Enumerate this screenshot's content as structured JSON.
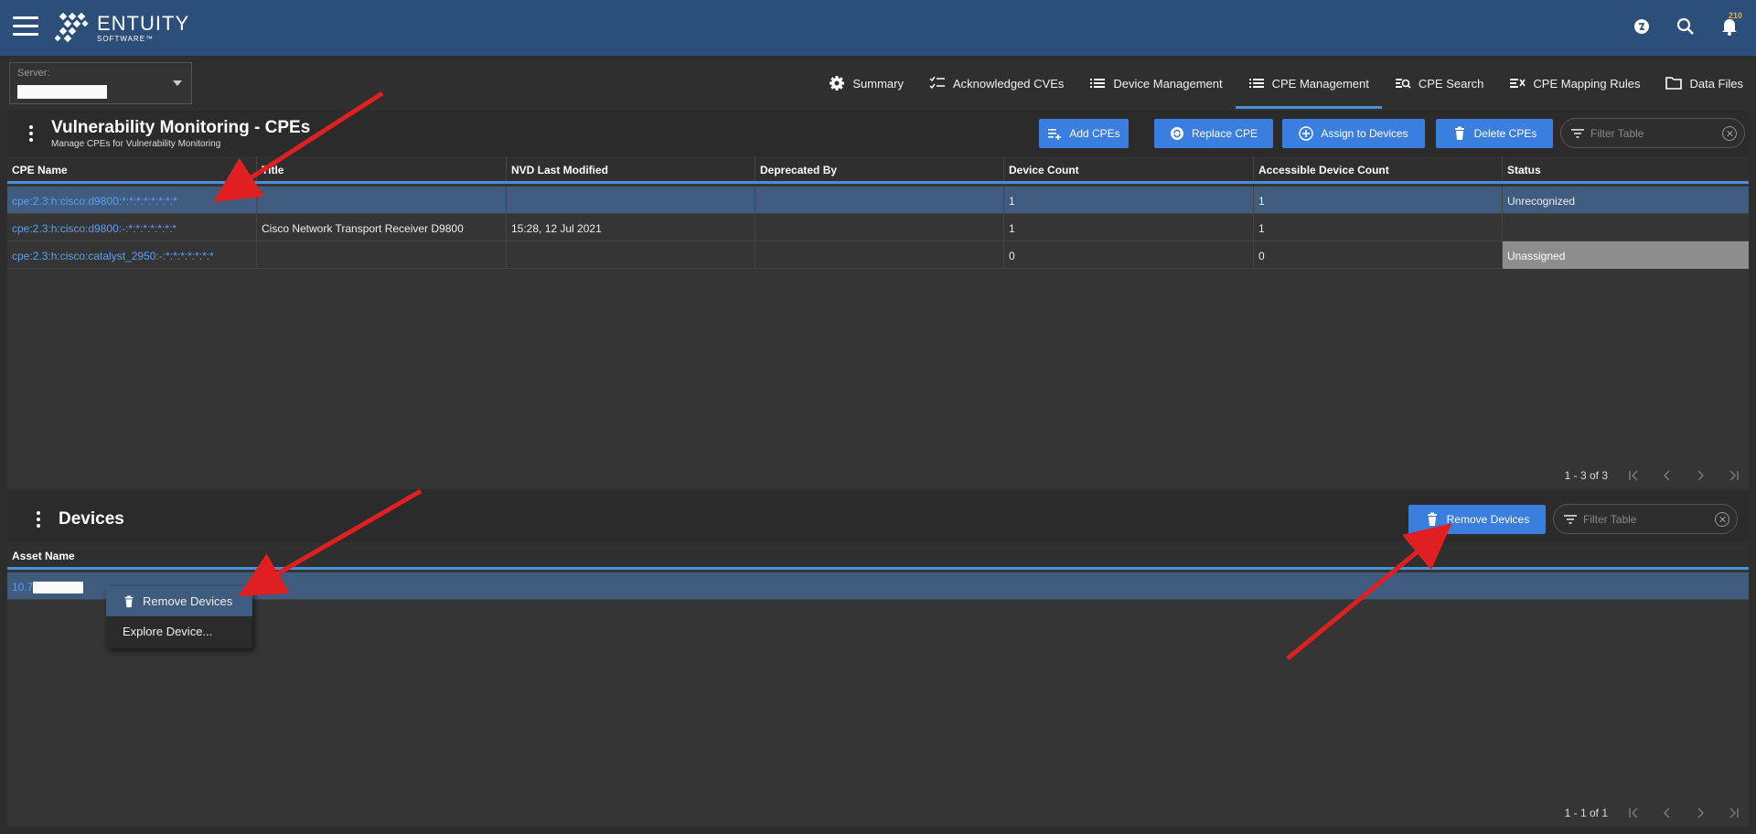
{
  "header": {
    "logo_main": "ENTUITY",
    "logo_sub": "SOFTWARE™",
    "notification_count": "210"
  },
  "server": {
    "label": "Server:"
  },
  "tabs": [
    {
      "label": "Summary",
      "icon": "gear-icon"
    },
    {
      "label": "Acknowledged CVEs",
      "icon": "checklist-icon"
    },
    {
      "label": "Device Management",
      "icon": "list-icon"
    },
    {
      "label": "CPE Management",
      "icon": "list-icon",
      "active": true
    },
    {
      "label": "CPE Search",
      "icon": "search-list-icon"
    },
    {
      "label": "CPE Mapping Rules",
      "icon": "mapping-icon"
    },
    {
      "label": "Data Files",
      "icon": "folder-icon"
    }
  ],
  "cpe_panel": {
    "title": "Vulnerability Monitoring - CPEs",
    "subtitle": "Manage CPEs for Vulnerability Monitoring",
    "buttons": {
      "add": "Add CPEs",
      "replace": "Replace CPE",
      "assign": "Assign to Devices",
      "delete": "Delete CPEs"
    },
    "filter_placeholder": "Filter Table",
    "columns": [
      "CPE Name",
      "Title",
      "NVD Last Modified",
      "Deprecated By",
      "Device Count",
      "Accessible Device Count",
      "Status"
    ],
    "rows": [
      {
        "cpe": "cpe:2.3:h:cisco:d9800:*:*:*:*:*:*:*:*",
        "title": "",
        "nvd": "",
        "deprecated": "",
        "count": "1",
        "accessible": "1",
        "status": "Unrecognized"
      },
      {
        "cpe": "cpe:2.3:h:cisco:d9800:-:*:*:*:*:*:*:*",
        "title": "Cisco Network Transport Receiver D9800",
        "nvd": "15:28, 12 Jul 2021",
        "deprecated": "",
        "count": "1",
        "accessible": "1",
        "status": ""
      },
      {
        "cpe": "cpe:2.3:h:cisco:catalyst_2950:-:*:*:*:*:*:*:*",
        "title": "",
        "nvd": "",
        "deprecated": "",
        "count": "0",
        "accessible": "0",
        "status": "Unassigned"
      }
    ],
    "pager": "1 - 3 of 3"
  },
  "devices_panel": {
    "title": "Devices",
    "remove_button": "Remove Devices",
    "filter_placeholder": "Filter Table",
    "columns": [
      "Asset Name"
    ],
    "rows": [
      {
        "asset": "10.7"
      }
    ],
    "pager": "1 - 1 of 1"
  },
  "context_menu": {
    "remove": "Remove Devices",
    "explore": "Explore Device..."
  },
  "colors": {
    "header_bg": "#2c4f7a",
    "accent": "#3a7fe0",
    "link": "#5aa0f0",
    "selected_row": "#3f5b7e",
    "arrow": "#e02020"
  }
}
